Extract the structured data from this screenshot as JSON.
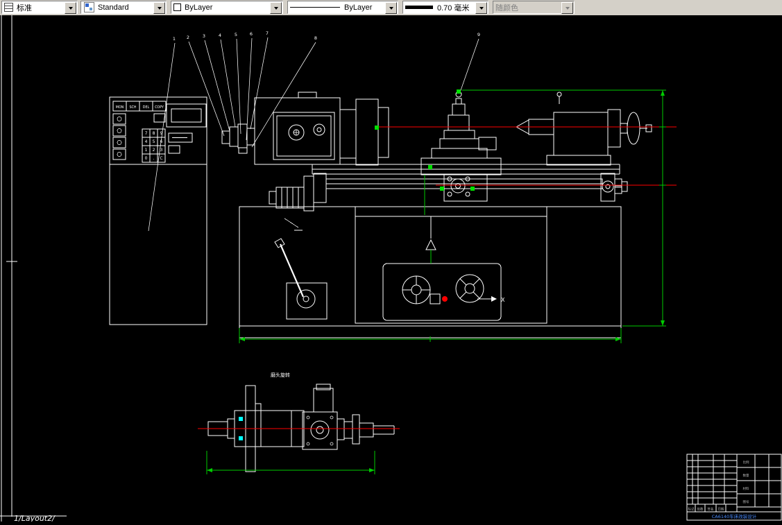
{
  "toolbar": {
    "dim_style": {
      "label": "标准"
    },
    "text_style": {
      "label": "Standard"
    },
    "color": {
      "label": "ByLayer"
    },
    "linetype": {
      "label": "ByLayer"
    },
    "lineweight": {
      "label": "0.70 毫米"
    },
    "plot_style": {
      "label": "随颜色",
      "enabled": false
    }
  },
  "drawing": {
    "control_panel": {
      "keys": [
        "MON",
        "SCH",
        "DEL",
        "COPY"
      ],
      "keypad": [
        "7",
        "8",
        "9",
        "4",
        "5",
        "6",
        "1",
        "2",
        "3",
        "0",
        ".",
        "C"
      ]
    },
    "callouts": [
      "1",
      "2",
      "3",
      "4",
      "5",
      "6",
      "7",
      "8",
      "9"
    ],
    "section_label": "X",
    "small_view_label": "磨头旋转",
    "title_block": {
      "title": "CA6140车床改装设计",
      "fields": [
        "标记",
        "处数",
        "签名",
        "日期",
        "比例",
        "数量",
        "材料",
        "图号"
      ]
    }
  },
  "statusbar": {
    "layout_tabs": "1/Layout2/"
  },
  "colors": {
    "background": "#000000",
    "geometry": "#ffffff",
    "dimension": "#00cc00",
    "centerline": "#ff0000",
    "grip": "#00e000",
    "highlight": "#00ffff",
    "title_text": "#4a8cff",
    "toolbar_bg": "#d4d0c8"
  }
}
